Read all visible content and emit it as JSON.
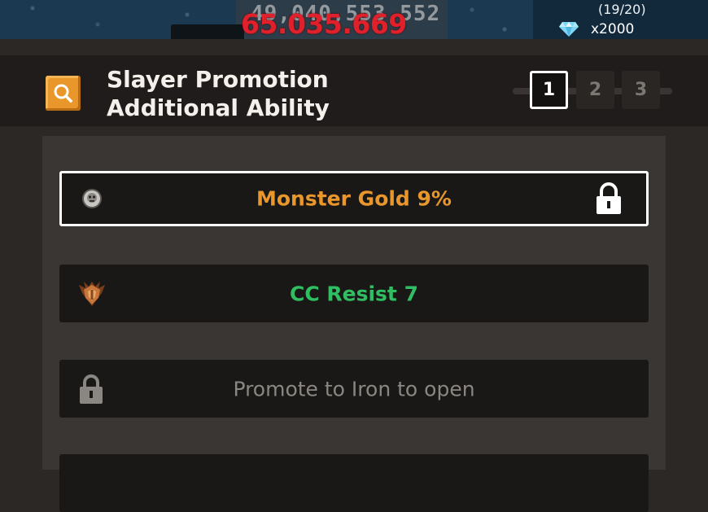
{
  "hud": {
    "ghost_damage": "49,040,553,552",
    "damage": "65.035.669",
    "attempts": "(19/20)",
    "gem_icon": "diamond-icon",
    "gems": "x2000"
  },
  "header": {
    "search_icon": "search-icon",
    "title": "Slayer Promotion Additional Ability",
    "pages": [
      "1",
      "2",
      "3"
    ],
    "active_page": "1"
  },
  "abilities": [
    {
      "icon": "monster-coin-icon",
      "label": "Monster Gold 9%",
      "color": "#e9962b",
      "locked_icon": "lock-icon",
      "selected": true
    },
    {
      "icon": "bronze-crest-icon",
      "label": "CC Resist 7",
      "color": "#2fbf62",
      "selected": false
    },
    {
      "icon": "lock-icon",
      "label": "Promote to Iron to open",
      "color": "#8a8682",
      "selected": false
    }
  ],
  "colors": {
    "accent_orange": "#e9962b",
    "panel_bg": "#3a3634",
    "row_bg": "#1a1817",
    "damage_red": "#e0202a"
  }
}
